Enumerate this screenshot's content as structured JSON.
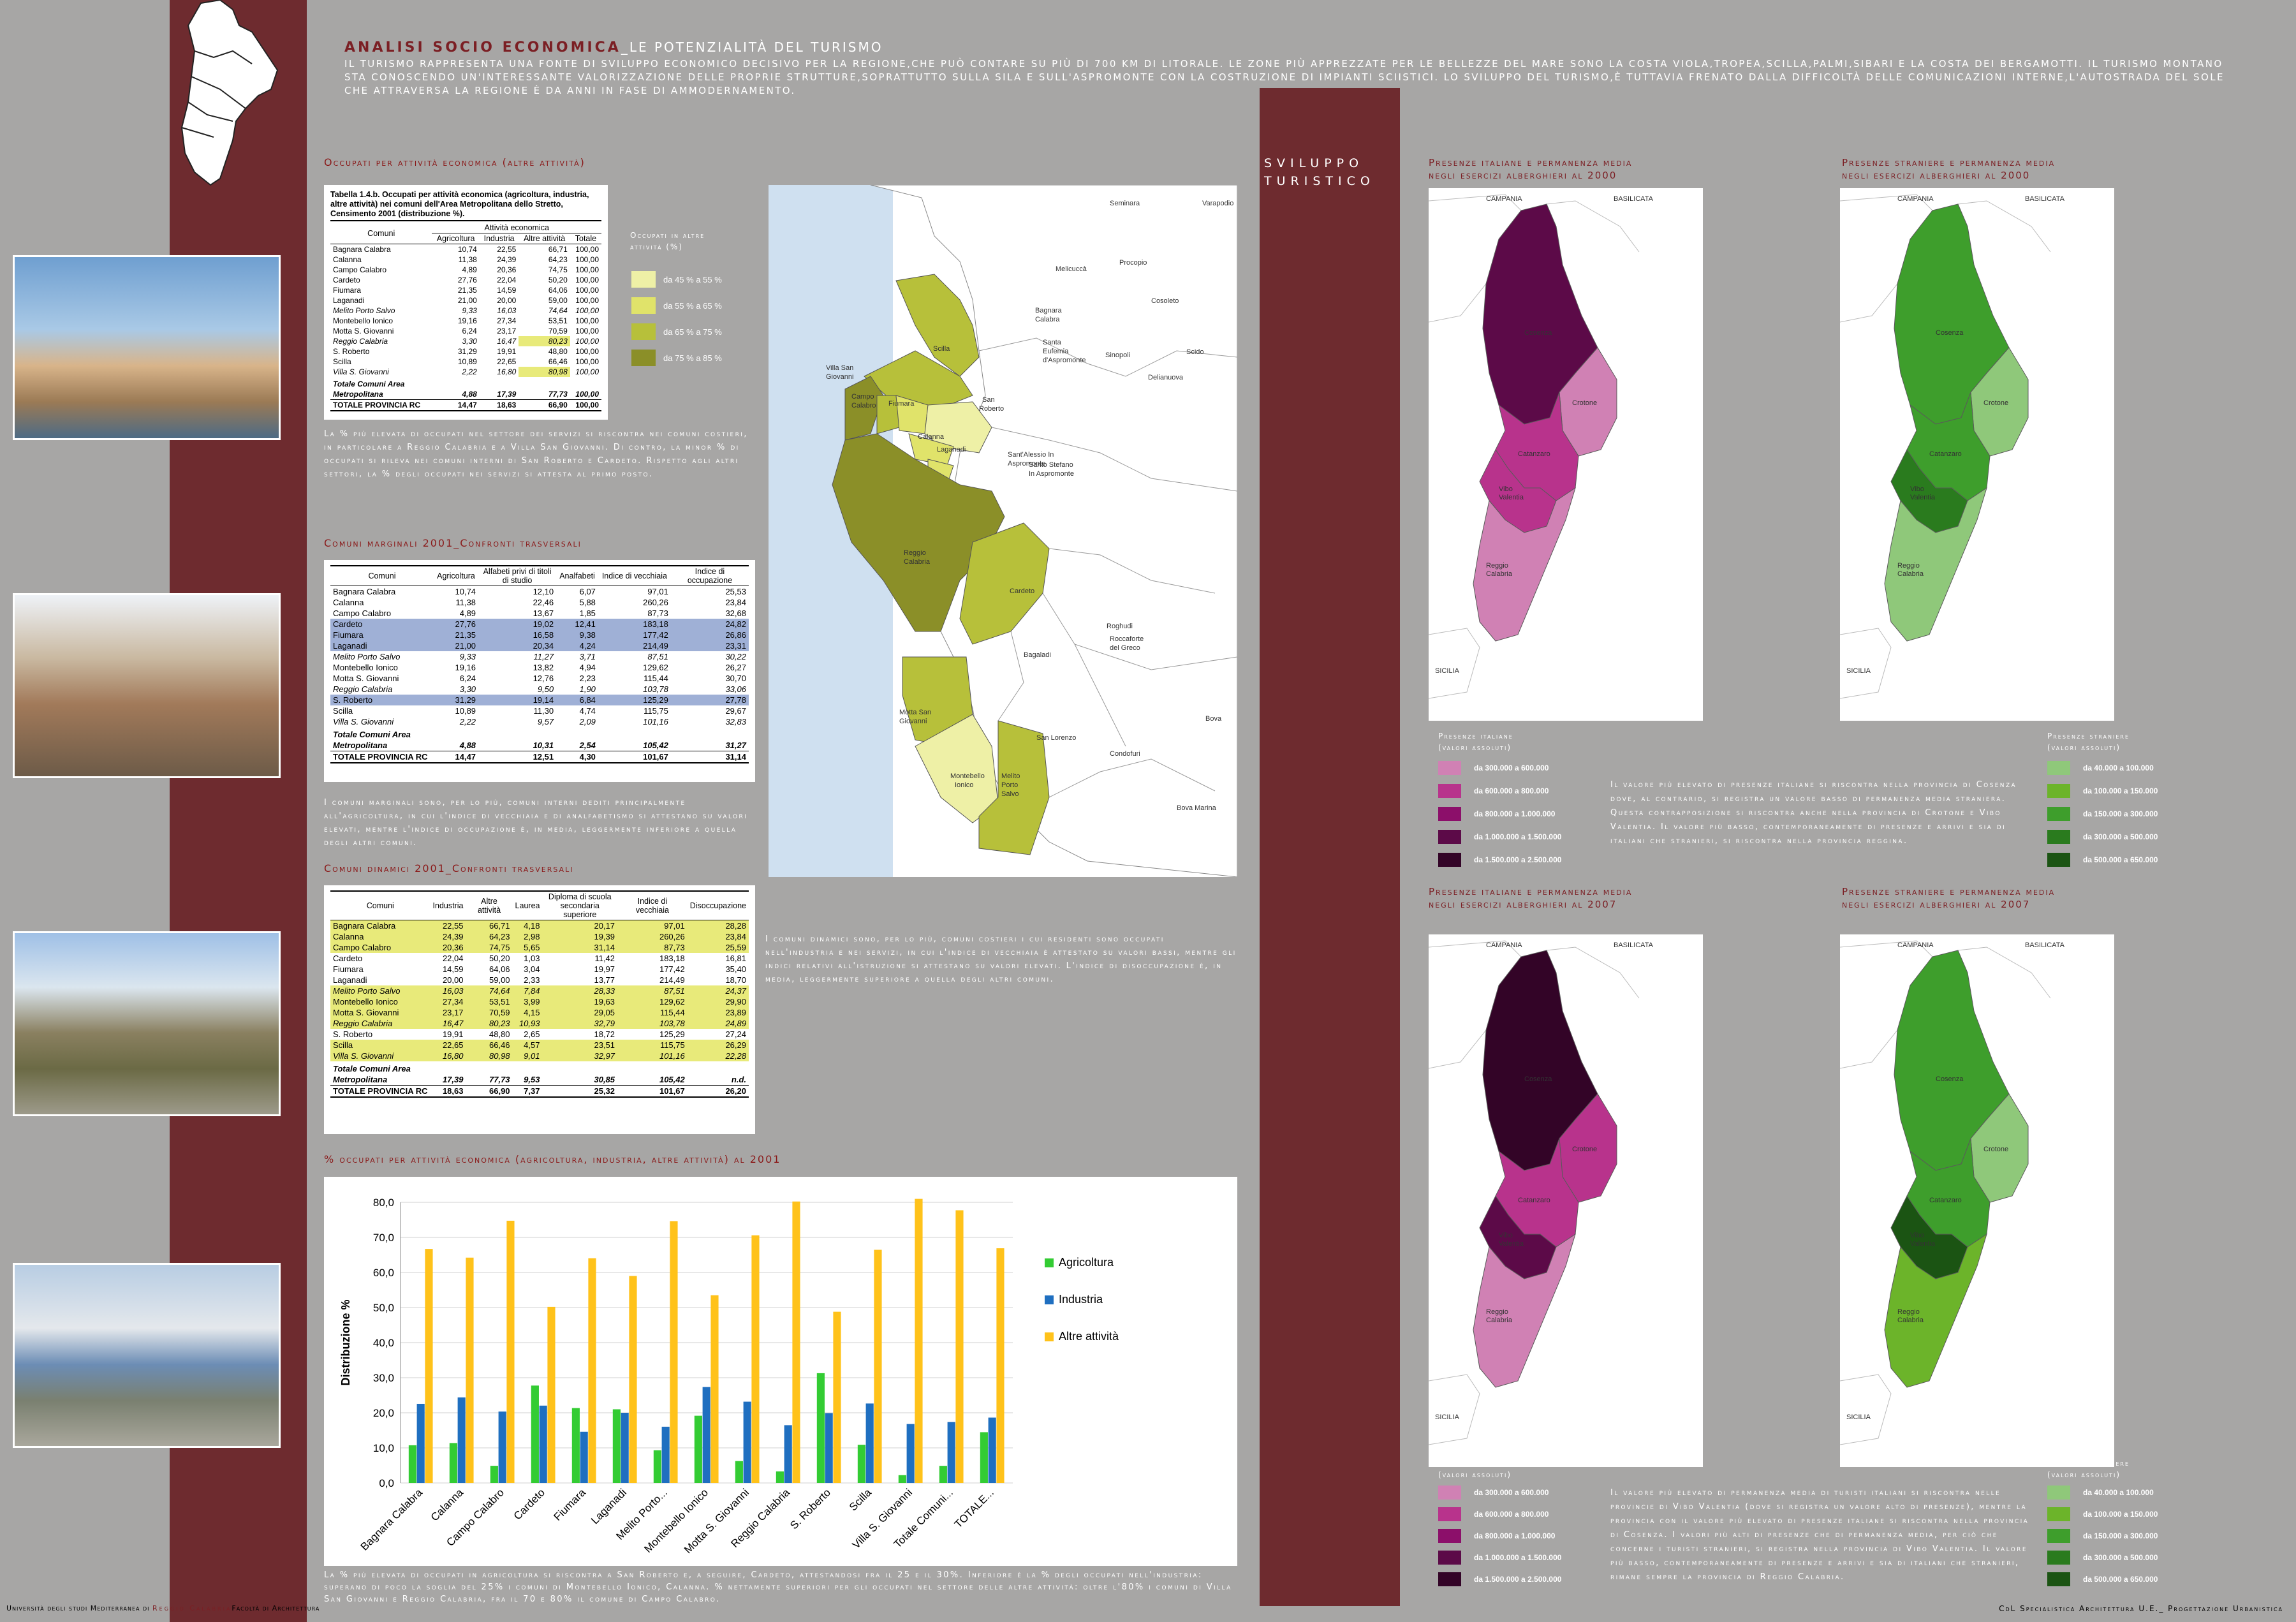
{
  "header": {
    "title": "ANALISI SOCIO ECONOMICA",
    "subtitle": "_LE POTENZIALITÀ DEL TURISMO",
    "intro": "IL TURISMO RAPPRESENTA UNA FONTE DI SVILUPPO ECONOMICO DECISIVO PER LA REGIONE,CHE PUÒ CONTARE SU PIÙ DI 700 KM DI LITORALE. LE ZONE PIÙ APPREZZATE PER LE BELLEZZE DEL MARE SONO LA COSTA VIOLA,TROPEA,SCILLA,PALMI,SIBARI E LA COSTA DEI BERGAMOTTI. IL TURISMO MONTANO STA CONOSCENDO UN'INTERESSANTE VALORIZZAZIONE DELLE PROPRIE STRUTTURE,SOPRATTUTTO SULLA SILA E SULL'ASPROMONTE CON LA COSTRUZIONE DI IMPIANTI SCIISTICI. LO SVILUPPO DEL TURISMO,È TUTTAVIA FRENATO DALLA DIFFICOLTÀ DELLE COMUNICAZIONI INTERNE,L'AUTOSTRADA DEL SOLE CHE ATTRAVERSA LA REGIONE È DA ANNI IN FASE DI AMMODERNAMENTO."
  },
  "sviluppo": {
    "line1": "SVILUPPO",
    "line2": "TURISTICO"
  },
  "section1": {
    "title": "Occupati per attività economica (altre attività)",
    "table_caption": "Tabella 1.4.b. Occupati per attività economica (agricoltura, industria, altre attività) nei comuni dell'Area Metropolitana dello Stretto, Censimento 2001 (distribuzione %).",
    "group_header": "Attività economica",
    "headers": [
      "Comuni",
      "Agricoltura",
      "Industria",
      "Altre attività",
      "Totale"
    ],
    "rows": [
      [
        "Bagnara Calabra",
        "10,74",
        "22,55",
        "66,71",
        "100,00"
      ],
      [
        "Calanna",
        "11,38",
        "24,39",
        "64,23",
        "100,00"
      ],
      [
        "Campo Calabro",
        "4,89",
        "20,36",
        "74,75",
        "100,00"
      ],
      [
        "Cardeto",
        "27,76",
        "22,04",
        "50,20",
        "100,00"
      ],
      [
        "Fiumara",
        "21,35",
        "14,59",
        "64,06",
        "100,00"
      ],
      [
        "Laganadi",
        "21,00",
        "20,00",
        "59,00",
        "100,00"
      ],
      [
        "Melito Porto Salvo",
        "9,33",
        "16,03",
        "74,64",
        "100,00"
      ],
      [
        "Montebello Ionico",
        "19,16",
        "27,34",
        "53,51",
        "100,00"
      ],
      [
        "Motta S. Giovanni",
        "6,24",
        "23,17",
        "70,59",
        "100,00"
      ],
      [
        "Reggio Calabria",
        "3,30",
        "16,47",
        "80,23",
        "100,00"
      ],
      [
        "S. Roberto",
        "31,29",
        "19,91",
        "48,80",
        "100,00"
      ],
      [
        "Scilla",
        "10,89",
        "22,65",
        "66,46",
        "100,00"
      ],
      [
        "Villa S. Giovanni",
        "2,22",
        "16,80",
        "80,98",
        "100,00"
      ]
    ],
    "total_label": "Totale Comuni Area",
    "metro_row": [
      "Metropolitana",
      "4,88",
      "17,39",
      "77,73",
      "100,00"
    ],
    "prov_row": [
      "TOTALE PROVINCIA RC",
      "14,47",
      "18,63",
      "66,90",
      "100,00"
    ],
    "legend_title": "Occupati in altre attività (%)",
    "legend": [
      {
        "label": "da 45 % a 55 %",
        "color": "#eef0a6"
      },
      {
        "label": "da 55 % a 65 %",
        "color": "#e0e36a"
      },
      {
        "label": "da 65 % a 75 %",
        "color": "#b7c03a"
      },
      {
        "label": "da 75 % a 85 %",
        "color": "#8b8f28"
      }
    ],
    "note": "La % più elevata di occupati nel settore dei servizi si riscontra nei comuni costieri, in particolare a Reggio Calabria e a Villa San Giovanni. Di contro, la minor % di occupati si rileva nei comuni interni di San Roberto e Cardeto. Rispetto agli altri settori, la % degli occupati nei servizi si attesta al primo posto."
  },
  "map1": {
    "labels": [
      "Seminara",
      "Varapodio",
      "Procopio",
      "Melicuccà",
      "Cosoleto",
      "Santa Eufemia d'Aspromonte",
      "Sinopoli",
      "Scido",
      "Delianuova",
      "Bagnara Calabra",
      "Scilla",
      "Villa San Giovanni",
      "Campo Calabro",
      "Fiumara",
      "San Roberto",
      "Calanna",
      "Laganadi",
      "Sant'Alessio In Aspromonte",
      "Santo Stefano In Aspromonte",
      "Reggio Calabria",
      "Cardeto",
      "Roghudi",
      "Bagaladi",
      "Roccaforte del Greco",
      "Motta San Giovanni",
      "Montebello Ionico",
      "Melito Porto Salvo",
      "San Lorenzo",
      "Condofuri",
      "Bova",
      "Bova Marina"
    ]
  },
  "section2": {
    "title": "Comuni marginali 2001_Confronti trasversali",
    "headers": [
      "Comuni",
      "Agricoltura",
      "Alfabeti privi di titoli di studio",
      "Analfabeti",
      "Indice di vecchiaia",
      "Indice di occupazione"
    ],
    "rows": [
      [
        "Bagnara Calabra",
        "10,74",
        "12,10",
        "6,07",
        "97,01",
        "25,53"
      ],
      [
        "Calanna",
        "11,38",
        "22,46",
        "5,88",
        "260,26",
        "23,84"
      ],
      [
        "Campo Calabro",
        "4,89",
        "13,67",
        "1,85",
        "87,73",
        "32,68"
      ],
      [
        "Cardeto",
        "27,76",
        "19,02",
        "12,41",
        "183,18",
        "24,82"
      ],
      [
        "Fiumara",
        "21,35",
        "16,58",
        "9,38",
        "177,42",
        "26,86"
      ],
      [
        "Laganadi",
        "21,00",
        "20,34",
        "4,24",
        "214,49",
        "23,31"
      ],
      [
        "Melito Porto Salvo",
        "9,33",
        "11,27",
        "3,71",
        "87,51",
        "30,22"
      ],
      [
        "Montebello Ionico",
        "19,16",
        "13,82",
        "4,94",
        "129,62",
        "26,27"
      ],
      [
        "Motta S. Giovanni",
        "6,24",
        "12,76",
        "2,23",
        "115,44",
        "30,70"
      ],
      [
        "Reggio Calabria",
        "3,30",
        "9,50",
        "1,90",
        "103,78",
        "33,06"
      ],
      [
        "S. Roberto",
        "31,29",
        "19,14",
        "6,84",
        "125,29",
        "27,78"
      ],
      [
        "Scilla",
        "10,89",
        "11,30",
        "4,74",
        "115,75",
        "29,67"
      ],
      [
        "Villa S. Giovanni",
        "2,22",
        "9,57",
        "2,09",
        "101,16",
        "32,83"
      ]
    ],
    "total_label": "Totale Comuni Area",
    "metro_row": [
      "Metropolitana",
      "4,88",
      "10,31",
      "2,54",
      "105,42",
      "31,27"
    ],
    "prov_row": [
      "TOTALE PROVINCIA RC",
      "14,47",
      "12,51",
      "4,30",
      "101,67",
      "31,14"
    ],
    "highlight_color": "#9fb0d6",
    "note": "I comuni marginali sono, per lo più, comuni interni dediti principalmente all'agricoltura, in cui l'indice di vecchiaia e di analfabetismo si attestano su valori elevati, mentre l'indice di occupazione è, in media, leggermente inferiore a quella degli altri comuni."
  },
  "section3": {
    "title": "Comuni dinamici 2001_Confronti trasversali",
    "headers": [
      "Comuni",
      "Industria",
      "Altre attività",
      "Laurea",
      "Diploma di scuola secondaria superiore",
      "Indice di vecchiaia",
      "Disoccupazione"
    ],
    "rows": [
      [
        "Bagnara Calabra",
        "22,55",
        "66,71",
        "4,18",
        "20,17",
        "97,01",
        "28,28"
      ],
      [
        "Calanna",
        "24,39",
        "64,23",
        "2,98",
        "19,39",
        "260,26",
        "23,84"
      ],
      [
        "Campo Calabro",
        "20,36",
        "74,75",
        "5,65",
        "31,14",
        "87,73",
        "25,59"
      ],
      [
        "Cardeto",
        "22,04",
        "50,20",
        "1,03",
        "11,42",
        "183,18",
        "16,81"
      ],
      [
        "Fiumara",
        "14,59",
        "64,06",
        "3,04",
        "19,97",
        "177,42",
        "35,40"
      ],
      [
        "Laganadi",
        "20,00",
        "59,00",
        "2,33",
        "13,77",
        "214,49",
        "18,70"
      ],
      [
        "Melito Porto Salvo",
        "16,03",
        "74,64",
        "7,84",
        "28,33",
        "87,51",
        "24,37"
      ],
      [
        "Montebello Ionico",
        "27,34",
        "53,51",
        "3,99",
        "19,63",
        "129,62",
        "29,90"
      ],
      [
        "Motta S. Giovanni",
        "23,17",
        "70,59",
        "4,15",
        "29,05",
        "115,44",
        "23,89"
      ],
      [
        "Reggio Calabria",
        "16,47",
        "80,23",
        "10,93",
        "32,79",
        "103,78",
        "24,89"
      ],
      [
        "S. Roberto",
        "19,91",
        "48,80",
        "2,65",
        "18,72",
        "125,29",
        "27,24"
      ],
      [
        "Scilla",
        "22,65",
        "66,46",
        "4,57",
        "23,51",
        "115,75",
        "26,29"
      ],
      [
        "Villa S. Giovanni",
        "16,80",
        "80,98",
        "9,01",
        "32,97",
        "101,16",
        "22,28"
      ]
    ],
    "total_label": "Totale Comuni Area",
    "metro_row": [
      "Metropolitana",
      "17,39",
      "77,73",
      "9,53",
      "30,85",
      "105,42",
      "n.d."
    ],
    "prov_row": [
      "TOTALE PROVINCIA RC",
      "18,63",
      "66,90",
      "7,37",
      "25,32",
      "101,67",
      "26,20"
    ],
    "highlight_color": "#e8ea7a",
    "note": "I comuni dinamici sono, per lo più, comuni costieri i cui residenti sono occupati nell'industria e nei servizi, in cui l'indice di vecchiaia è attestato su valori bassi, mentre gli indici relativi all'istruzione si attestano su valori elevati. L'indice di disoccupazione è, in media, leggermente superiore a quella degli altri comuni."
  },
  "section4": {
    "title": "% occupati per attività economica (agricoltura, industria, altre attività) al 2001",
    "note": "La % più elevata di occupati in agricoltura si riscontra a San Roberto e, a seguire, Cardeto, attestandosi fra il 25 e il 30%. Inferiore è la % degli occupati nell'industria: superano di poco la soglia del 25% i comuni di Montebello Ionico, Calanna. % nettamente superiori per gli occupati nel settore delle altre attività: oltre l'80% i comuni di Villa San Giovanni e Reggio Calabria, fra il 70 e 80% il comune di Campo Calabro."
  },
  "chart_data": {
    "type": "bar",
    "categories": [
      "Bagnara Calabra",
      "Calanna",
      "Campo Calabro",
      "Cardeto",
      "Fiumara",
      "Laganadi",
      "Melito Porto...",
      "Montebello Ionico",
      "Motta S. Giovanni",
      "Reggio Calabria",
      "S. Roberto",
      "Scilla",
      "Villa S. Giovanni",
      "Totale Comuni...",
      "TOTALE..."
    ],
    "series": [
      {
        "name": "Agricoltura",
        "color": "#33cc33",
        "values": [
          10.74,
          11.38,
          4.89,
          27.76,
          21.35,
          21.0,
          9.33,
          19.16,
          6.24,
          3.3,
          31.29,
          10.89,
          2.22,
          4.88,
          14.47
        ]
      },
      {
        "name": "Industria",
        "color": "#1f6fc0",
        "values": [
          22.55,
          24.39,
          20.36,
          22.04,
          14.59,
          20.0,
          16.03,
          27.34,
          23.17,
          16.47,
          19.91,
          22.65,
          16.8,
          17.39,
          18.63
        ]
      },
      {
        "name": "Altre attività",
        "color": "#ffc21a",
        "values": [
          66.71,
          64.23,
          74.75,
          50.2,
          64.06,
          59.0,
          74.64,
          53.51,
          70.59,
          80.23,
          48.8,
          66.46,
          80.98,
          77.73,
          66.9
        ]
      }
    ],
    "ylabel": "Distribuzione %",
    "ylim": [
      0,
      80
    ],
    "yticks": [
      "0,0",
      "10,0",
      "20,0",
      "30,0",
      "40,0",
      "50,0",
      "60,0",
      "70,0",
      "80,0"
    ],
    "legend_position": "right",
    "grid": true
  },
  "maps": {
    "it2000_title": [
      "Presenze italiane e permanenza media",
      "negli esercizi alberghieri al 2000"
    ],
    "st2000_title": [
      "Presenze straniere e permanenza media",
      "negli esercizi alberghieri al 2000"
    ],
    "it2007_title": [
      "Presenze italiane e permanenza media",
      "negli esercizi alberghieri al 2007"
    ],
    "st2007_title": [
      "Presenze straniere e permanenza media",
      "negli esercizi alberghieri al 2007"
    ],
    "labels": {
      "campania": "CAMPANIA",
      "basilicata": "BASILICATA",
      "sicilia": "SICILIA",
      "cosenza": "Cosenza",
      "crotone": "Crotone",
      "catanzaro": "Catanzaro",
      "vibo": "Vibo Valentia",
      "reggio": "Reggio Calabria"
    },
    "it_legend_title": [
      "Presenze italiane",
      "(valori assoluti)"
    ],
    "st_legend_title": [
      "Presenze straniere",
      "(valori assoluti)"
    ],
    "it_legend": [
      {
        "label": "da 300.000 a 600.000",
        "color": "#d081b4"
      },
      {
        "label": "da 600.000 a 800.000",
        "color": "#b8338c"
      },
      {
        "label": "da 800.000 a 1.000.000",
        "color": "#8c0f6a"
      },
      {
        "label": "da 1.000.000 a 1.500.000",
        "color": "#5c0a48"
      },
      {
        "label": "da 1.500.000 a 2.500.000",
        "color": "#330427"
      }
    ],
    "st_legend": [
      {
        "label": "da 40.000 a 100.000",
        "color": "#8fc87a"
      },
      {
        "label": "da 100.000 a 150.000",
        "color": "#6cb42a"
      },
      {
        "label": "da 150.000 a 300.000",
        "color": "#3e9e2c"
      },
      {
        "label": "da 300.000 a 500.000",
        "color": "#2a7b1e"
      },
      {
        "label": "da 500.000 a 650.000",
        "color": "#1b5413"
      }
    ],
    "note2000": "Il valore più elevato di presenze italiane si riscontra nella provincia di Cosenza dove, al contrario, si registra un valore basso di permanenza media straniera. Questa contrapposizione si riscontra anche nella provincia di Crotone e Vibo Valentia. Il valore più basso, contemporaneamente di presenze e arrivi e sia di italiani che stranieri, si riscontra nella provincia reggina.",
    "note2007": "Il valore più elevato di permanenza media di turisti italiani si riscontra nelle provincie di Vibo Valentia (dove si registra un valore alto di presenze), mentre la provincia con il valore più elevato di presenze italiane si riscontra nella provincia di Cosenza. I valori più alti di presenze che di permanenza media, per ciò che concerne i turisti stranieri, si registra nella provincia di Vibo Valentia. Il valore più basso, contemporaneamente di presenze e arrivi e sia di italiani che stranieri, rimane sempre la provincia di Reggio Calabria."
  },
  "footer": {
    "left_a": "Università degli studi Mediterranea di ",
    "left_b": "Reggio Calabria",
    "left_c": "Facoltà di Architettura",
    "right": "CdL Specialistica Architettura U.E._ Progettazione Urbanistica"
  }
}
